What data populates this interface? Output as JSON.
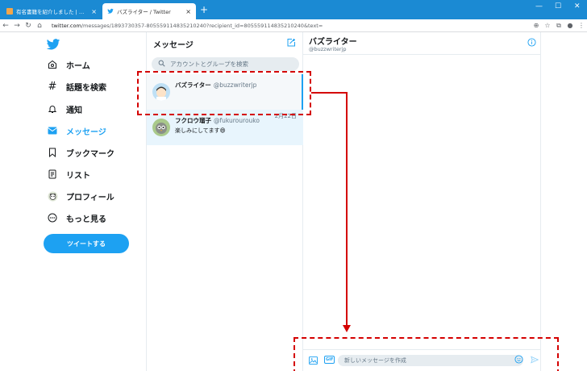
{
  "browser": {
    "tabs": [
      {
        "title": "有名書籍を紹介しました | バズブログ",
        "close": "×"
      },
      {
        "title": "バズライター / Twitter",
        "close": "×"
      }
    ],
    "new_tab": "+",
    "url_host": "twitter.com",
    "url_path": "/messages/1893730357-805559114835210240?recipient_id=805559114835210240&text="
  },
  "sidebar": {
    "items": [
      {
        "label": "ホーム",
        "icon": "home-icon"
      },
      {
        "label": "話題を検索",
        "icon": "hashtag-icon"
      },
      {
        "label": "通知",
        "icon": "bell-icon"
      },
      {
        "label": "メッセージ",
        "icon": "envelope-icon"
      },
      {
        "label": "ブックマーク",
        "icon": "bookmark-icon"
      },
      {
        "label": "リスト",
        "icon": "list-icon"
      },
      {
        "label": "プロフィール",
        "icon": "profile-avatar-icon"
      },
      {
        "label": "もっと見る",
        "icon": "more-icon"
      }
    ],
    "tweet_button": "ツイートする"
  },
  "messages": {
    "title": "メッセージ",
    "search_placeholder": "アカウントとグループを検索",
    "conversations": [
      {
        "name": "バズライター",
        "handle": "@buzzwriterjp",
        "date": "",
        "text": ""
      },
      {
        "name": "フクロウ瑠子",
        "handle": "@fukurourouko",
        "date": "2月22日",
        "text": "楽しみにしてます😄"
      }
    ]
  },
  "chat": {
    "name": "バズライター",
    "handle": "@buzzwriterjp",
    "input_placeholder": "新しいメッセージを作成",
    "gif_label": "GIF"
  },
  "colors": {
    "accent": "#1da1f2",
    "annotation": "#d40000"
  }
}
